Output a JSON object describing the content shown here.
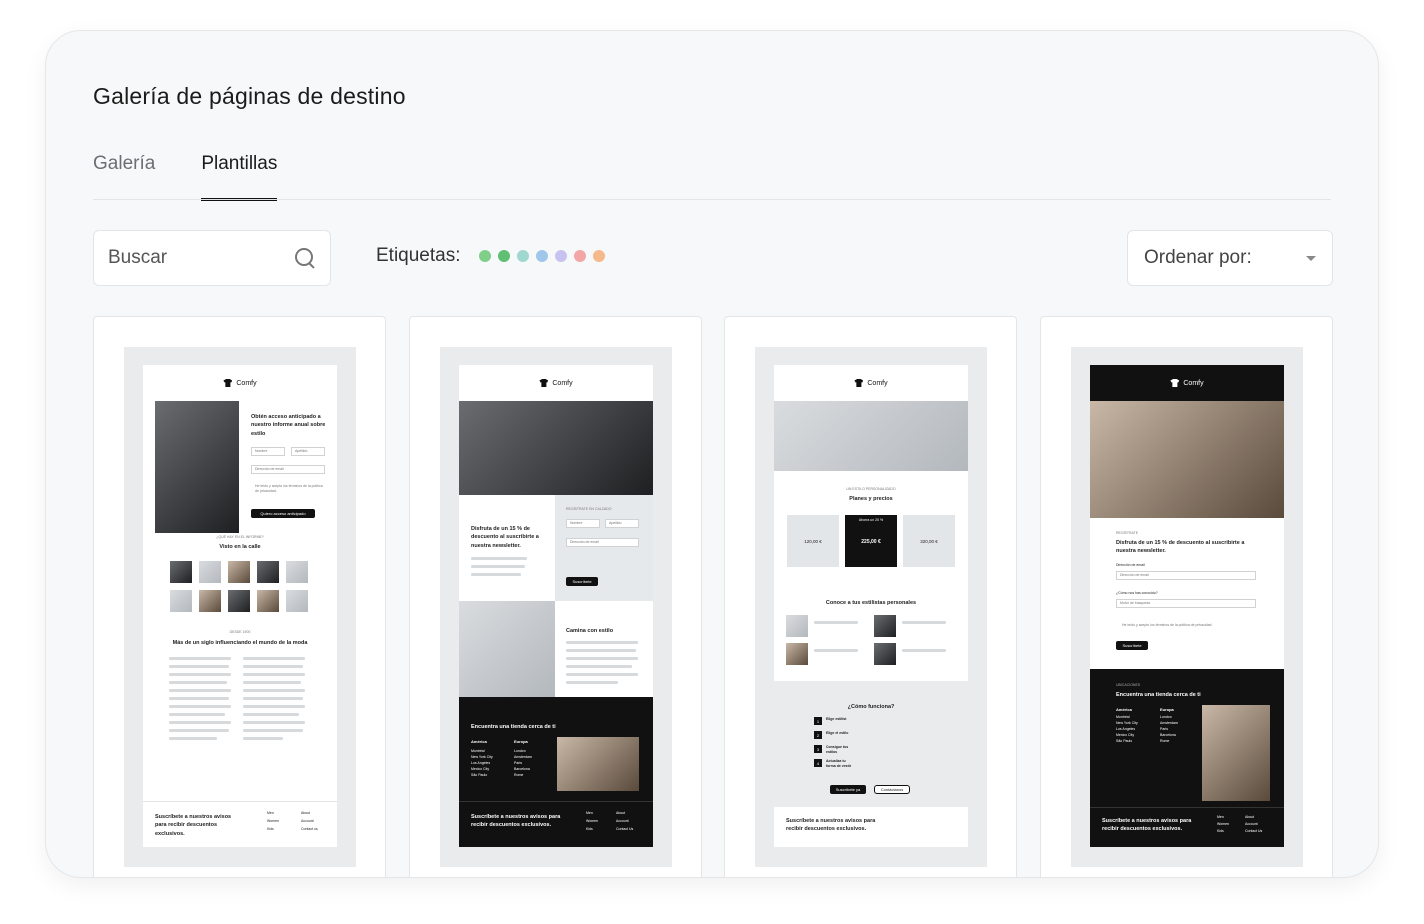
{
  "header": {
    "title": "Galería de páginas de destino"
  },
  "tabs": [
    {
      "label": "Galería",
      "active": false
    },
    {
      "label": "Plantillas",
      "active": true
    }
  ],
  "search": {
    "placeholder": "Buscar"
  },
  "tags": {
    "label": "Etiquetas:",
    "colors": [
      "#7fcf8a",
      "#5fbf72",
      "#9fd8cf",
      "#9fc7ec",
      "#c8c2f0",
      "#f3a6a6",
      "#f5b98c"
    ]
  },
  "sort": {
    "label": "Ordenar por:"
  },
  "brand": "Comfy",
  "templates": [
    {
      "form_title": "Obtén acceso anticipado a nuestro informe anual sobre estilo",
      "field_name": "Nombre",
      "field_last": "Apellido",
      "field_email": "Dirección de email",
      "consent": "He leído y acepto los términos de la política de privacidad.",
      "cta": "Quiero acceso anticipado",
      "kicker": "¿QUÉ HAY EN EL INFORME?",
      "section_title": "Visto en la calle",
      "kicker2": "DESDE 1900",
      "history_title": "Más de un siglo influenciando el mundo de la moda",
      "footer_text": "Suscríbete a nuestros avisos para recibir descuentos exclusivos.",
      "footer_links": [
        "Men",
        "Women",
        "Kids",
        "About",
        "Account",
        "Contact us"
      ]
    },
    {
      "hero_title": "Disfruta de un 15 % de descuento al suscribirte a nuestra newsletter.",
      "kicker": "REGÍSTRATE EN CALZADO",
      "field_name": "Nombre",
      "field_last": "Apellido",
      "field_email": "Dirección de email",
      "cta": "Suscríbete",
      "section_title": "Camina con estilo",
      "store_title": "Encuentra una tienda cerca de ti",
      "col1_title": "América",
      "col1": [
        "Montréal",
        "New York City",
        "Los Angeles",
        "Mexico City",
        "São Paulo"
      ],
      "col2_title": "Europa",
      "col2": [
        "London",
        "Amsterdam",
        "Paris",
        "Barcelona",
        "Rome"
      ],
      "footer_text": "Suscríbete a nuestros avisos para recibir descuentos exclusivos.",
      "footer_links": [
        "Men",
        "Women",
        "Kids",
        "About",
        "Account",
        "Contact Us"
      ]
    },
    {
      "kicker": "UN ESTILO PERSONALIZADO",
      "plans_title": "Planes y precios",
      "badge": "Ahorra un 20 %",
      "prices": [
        "120,00 €",
        "225,00 €",
        "320,00 €"
      ],
      "stylists_title": "Conoce a tus estilistas personales",
      "how_title": "¿Cómo funciona?",
      "steps": [
        "Elige estilist",
        "Elige el estilo",
        "Consigue tus estilos",
        "Actualiza tu forma de vestir"
      ],
      "cta1": "Suscríbete ya",
      "cta2": "Contáctanos",
      "footer_text": "Suscríbete a nuestros avisos para recibir descuentos exclusivos."
    },
    {
      "kicker": "REGÍSTRATE",
      "hero_title": "Disfruta de un 15 % de descuento al suscribirte a nuestra newsletter.",
      "email_label": "Dirección de email",
      "email_placeholder": "Dirección de email",
      "source_label": "¿Cómo nos has conocido?",
      "source_value": "Motor de búsqueda",
      "consent": "He leído y acepto los términos de la política de privacidad.",
      "cta": "Suscríbete",
      "kicker2": "UBICACIONES",
      "store_title": "Encuentra una tienda cerca de ti",
      "col1_title": "América",
      "col1": [
        "Montréal",
        "New York City",
        "Los Angeles",
        "Mexico City",
        "São Paulo"
      ],
      "col2_title": "Europa",
      "col2": [
        "London",
        "Amsterdam",
        "Paris",
        "Barcelona",
        "Rome"
      ],
      "footer_text": "Suscríbete a nuestros avisos para recibir descuentos exclusivos.",
      "footer_links": [
        "Men",
        "Women",
        "Kids",
        "About",
        "Account",
        "Contact Us"
      ]
    }
  ]
}
